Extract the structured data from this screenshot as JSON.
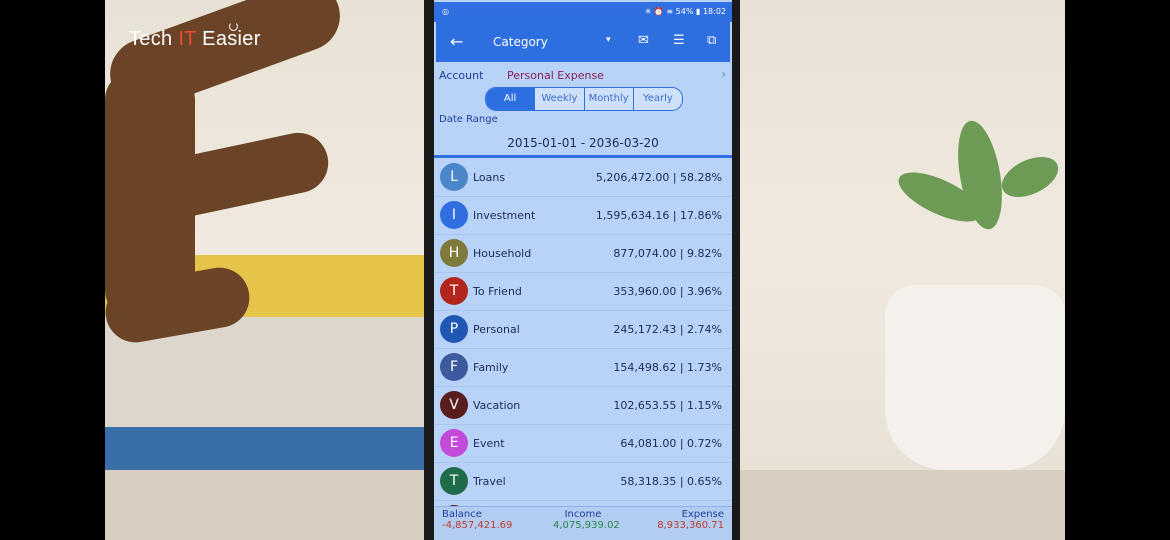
{
  "brand": {
    "part1": "Tech ",
    "part2": "IT",
    "part3": " Easier"
  },
  "status": {
    "left": "◎",
    "right": "✳ ⏰ ≡ 54% ▮ 18:02"
  },
  "appbar": {
    "back_icon": "←",
    "title": "Category",
    "dropdown_icon": "▾",
    "mail_icon": "✉",
    "menu_icon": "☰",
    "select_icon": "⧉"
  },
  "account": {
    "label": "Account",
    "value": "Personal Expense",
    "chevron": "›"
  },
  "periods": [
    "All",
    "Weekly",
    "Monthly",
    "Yearly"
  ],
  "date_range": {
    "label": "Date Range",
    "value": "2015-01-01 - 2036-03-20"
  },
  "categories": [
    {
      "letter": "L",
      "name": "Loans",
      "amount": "5,206,472.00 | 58.28%",
      "color": "#4a86c8"
    },
    {
      "letter": "I",
      "name": "Investment",
      "amount": "1,595,634.16 | 17.86%",
      "color": "#2f6fe0"
    },
    {
      "letter": "H",
      "name": "Household",
      "amount": "877,074.00 | 9.82%",
      "color": "#7d7a3c"
    },
    {
      "letter": "T",
      "name": "To Friend",
      "amount": "353,960.00 | 3.96%",
      "color": "#b3261e"
    },
    {
      "letter": "P",
      "name": "Personal",
      "amount": "245,172.43 | 2.74%",
      "color": "#2057b5"
    },
    {
      "letter": "F",
      "name": "Family",
      "amount": "154,498.62 | 1.73%",
      "color": "#3e5a9e"
    },
    {
      "letter": "V",
      "name": "Vacation",
      "amount": "102,653.55 | 1.15%",
      "color": "#5a1d1d"
    },
    {
      "letter": "E",
      "name": "Event",
      "amount": "64,081.00 | 0.72%",
      "color": "#c34bd9"
    },
    {
      "letter": "T",
      "name": "Travel",
      "amount": "58,318.35 | 0.65%",
      "color": "#1f6b4a"
    }
  ],
  "footer": {
    "balance_label": "Balance",
    "balance_value": "-4,857,421.69",
    "income_label": "Income",
    "income_value": "4,075,939.02",
    "expense_label": "Expense",
    "expense_value": "8,933,360.71"
  }
}
